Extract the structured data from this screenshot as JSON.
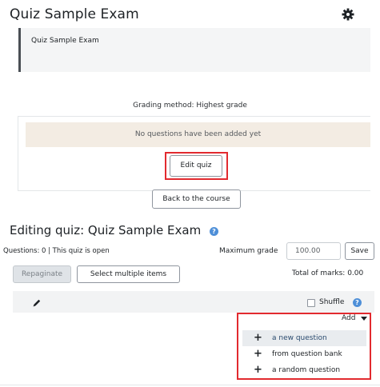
{
  "header": {
    "title": "Quiz Sample Exam",
    "settings_icon": "gear-icon"
  },
  "description": "Quiz Sample Exam",
  "grading_method": "Grading method: Highest grade",
  "quiz_panel": {
    "notice": "No questions have been added yet",
    "edit_button": "Edit quiz"
  },
  "back_button": "Back to the course",
  "editing": {
    "title": "Editing quiz: Quiz Sample Exam",
    "help_icon": "question-circle-icon",
    "status": "Questions: 0 | This quiz is open",
    "max_grade_label": "Maximum grade",
    "max_grade_value": "100.00",
    "save_button": "Save",
    "repaginate_button": "Repaginate",
    "select_multiple_button": "Select multiple items",
    "total_marks": "Total of marks: 0.00",
    "shuffle_label": "Shuffle",
    "shuffle_checked": false,
    "add_label": "Add",
    "add_menu": [
      {
        "label": "a new question",
        "icon": "plus-icon",
        "highlighted": true
      },
      {
        "label": "from question bank",
        "icon": "plus-icon",
        "highlighted": false
      },
      {
        "label": "a random question",
        "icon": "plus-icon",
        "highlighted": false
      }
    ]
  },
  "colors": {
    "highlight_border": "#e22a2f",
    "notice_bg": "#f3ece3",
    "help_blue": "#4e8fd8"
  }
}
